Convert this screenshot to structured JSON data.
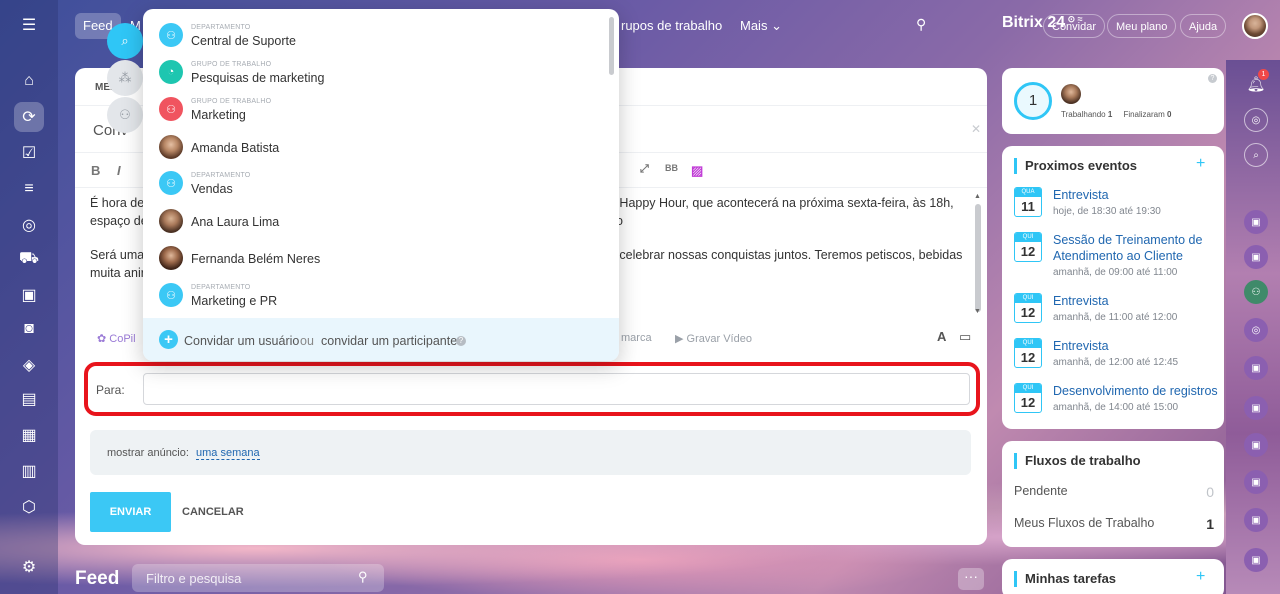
{
  "topbar": {
    "tab_feed": "Feed",
    "tab_m": "M",
    "tab_grupos": "rupos de trabalho",
    "tab_mais": "Mais",
    "logo": "Bitrix 24",
    "invite": "Convidar",
    "plan": "Meu plano",
    "help": "Ajuda"
  },
  "composer": {
    "tab_label": "MEN",
    "title": "Conv",
    "body_p1_left": "É hora de",
    "body_p1_left2": "espaço de",
    "body_p1_right": "o Happy Hour, que acontecerá na próxima sexta-feira, às 18h, no",
    "body_p2_left": "Será uma",
    "body_p2_left2": "muita anir",
    "body_p2_right": "e celebrar nossas conquistas juntos. Teremos petiscos, bebidas e",
    "action_copilot": "CoPil",
    "action_marca": "marca",
    "action_video": "Gravar Vídeo",
    "to_label": "Para:",
    "announce_label": "mostrar anúncio:",
    "announce_value": "uma semana",
    "send": "ENVIAR",
    "cancel": "CANCELAR"
  },
  "dropdown": {
    "items": [
      {
        "type": "DEPARTAMENTO",
        "name": "Central de Suporte",
        "color": "#3bc8f5"
      },
      {
        "type": "GRUPO DE TRABALHO",
        "name": "Pesquisas de marketing",
        "color": "#1ec6b0"
      },
      {
        "type": "GRUPO DE TRABALHO",
        "name": "Marketing",
        "color": "#f0545f"
      },
      {
        "type": "",
        "name": "Amanda Batista",
        "color": ""
      },
      {
        "type": "DEPARTAMENTO",
        "name": "Vendas",
        "color": "#3bc8f5"
      },
      {
        "type": "",
        "name": "Ana Laura Lima",
        "color": ""
      },
      {
        "type": "",
        "name": "Fernanda Belém Neres",
        "color": ""
      },
      {
        "type": "DEPARTAMENTO",
        "name": "Marketing e PR",
        "color": "#3bc8f5"
      }
    ],
    "invite_user": "Convidar um usuário",
    "or": "ou",
    "invite_participant": "convidar um participante"
  },
  "feed": {
    "title": "Feed",
    "search_placeholder": "Filtro e pesquisa"
  },
  "sidebar": {
    "counter": "1",
    "working_label": "Trabalhando",
    "working_count": "1",
    "finished_label": "Finalizaram",
    "finished_count": "0",
    "events_title": "Proximos eventos",
    "events": [
      {
        "day": "QUA",
        "num": "11",
        "title": "Entrevista",
        "time": "hoje, de 18:30 até 19:30"
      },
      {
        "day": "QUI",
        "num": "12",
        "title": "Sessão de Treinamento de Atendimento ao Cliente",
        "time": "amanhã, de 09:00 até 11:00"
      },
      {
        "day": "QUI",
        "num": "12",
        "title": "Entrevista",
        "time": "amanhã, de 11:00 até 12:00"
      },
      {
        "day": "QUI",
        "num": "12",
        "title": "Entrevista",
        "time": "amanhã, de 12:00 até 12:45"
      },
      {
        "day": "QUI",
        "num": "12",
        "title": "Desenvolvimento de registros",
        "time": "amanhã, de 14:00 até 15:00"
      }
    ],
    "flows_title": "Fluxos de trabalho",
    "pending_label": "Pendente",
    "pending_value": "0",
    "my_flows_label": "Meus Fluxos de Trabalho",
    "my_flows_value": "1",
    "tasks_title": "Minhas tarefas",
    "notif_badge": "1"
  }
}
